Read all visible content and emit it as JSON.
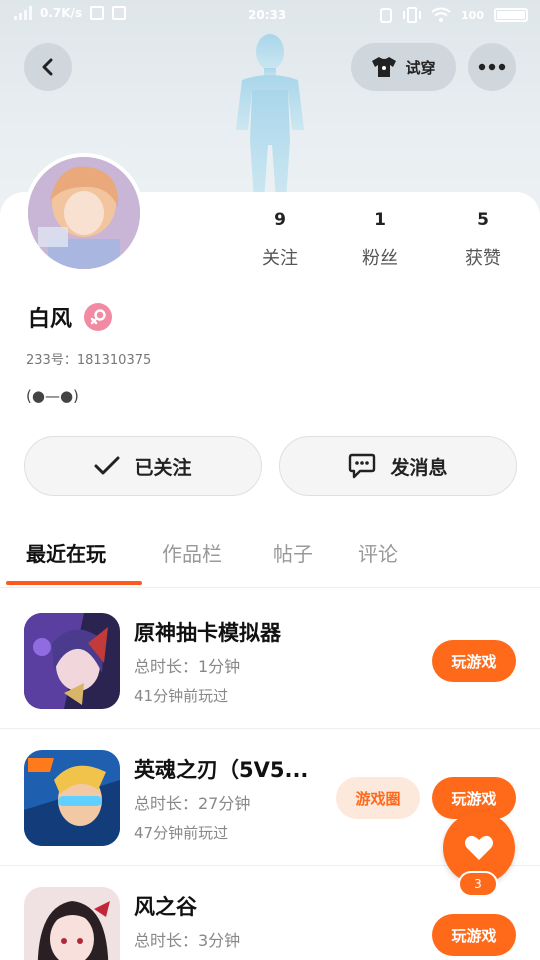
{
  "status_bar": {
    "speed": "0.7K/s",
    "time": "20:33",
    "battery": "100"
  },
  "header": {
    "tryon_label": "试穿"
  },
  "profile": {
    "stats": [
      {
        "value": "9",
        "label": "关注"
      },
      {
        "value": "1",
        "label": "粉丝"
      },
      {
        "value": "5",
        "label": "获赞"
      }
    ],
    "name": "白风",
    "gender": "female",
    "id_text": "233号：181310375",
    "signature": "(●—●)"
  },
  "actions": {
    "follow_label": "已关注",
    "message_label": "发消息"
  },
  "tabs": [
    "最近在玩",
    "作品栏",
    "帖子",
    "评论"
  ],
  "games": [
    {
      "title": "原神抽卡模拟器",
      "duration": "总时长：1分钟",
      "last_played": "41分钟前玩过",
      "play_label": "玩游戏",
      "circle_label": ""
    },
    {
      "title": "英魂之刃（5V5...",
      "duration": "总时长：27分钟",
      "last_played": "47分钟前玩过",
      "play_label": "玩游戏",
      "circle_label": "游戏圈"
    },
    {
      "title": "风之谷",
      "duration": "总时长：3分钟",
      "last_played": "",
      "play_label": "玩游戏",
      "circle_label": ""
    }
  ],
  "like": {
    "count": "3"
  },
  "colors": {
    "accent": "#ff6a1a",
    "tab_indicator": "#ff5a1f",
    "gender_badge": "#f38aa4"
  }
}
